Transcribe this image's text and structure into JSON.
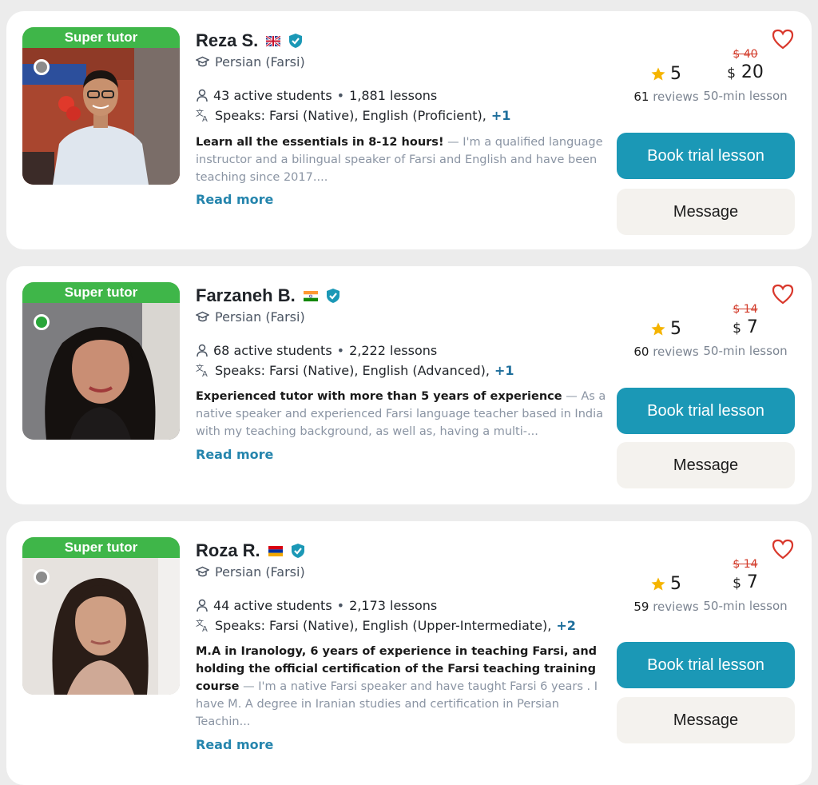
{
  "colors": {
    "super_badge": "#3fb649",
    "book_button": "#1b98b6",
    "message_button": "#f4f2ee",
    "old_price": "#d23b2a",
    "heart": "#d9372b",
    "star": "#f5b400",
    "verified": "#1b98b6",
    "link": "#2585ad"
  },
  "tutors": [
    {
      "badge": "Super tutor",
      "status": "offline",
      "name": "Reza S.",
      "flag": "uk-flag-icon",
      "subject": "Persian (Farsi)",
      "students": "43 active students",
      "lessons": "1,881 lessons",
      "speaks": "Speaks: Farsi (Native), English (Proficient),",
      "more_langs": "+1",
      "headline": "Learn all the essentials in 8-12 hours!",
      "description": " — I'm a qualified language instructor and a bilingual speaker of Farsi and English and have been teaching since 2017....",
      "read_more": "Read more",
      "rating": "5",
      "reviews_count": "61",
      "reviews_label": "reviews",
      "old_price": "$ 40",
      "currency": "$",
      "price": "20",
      "lesson_length": "50-min lesson",
      "book_label": "Book trial lesson",
      "message_label": "Message"
    },
    {
      "badge": "Super tutor",
      "status": "online",
      "name": "Farzaneh B.",
      "flag": "india-flag-icon",
      "subject": "Persian (Farsi)",
      "students": "68 active students",
      "lessons": "2,222 lessons",
      "speaks": "Speaks: Farsi (Native), English (Advanced),",
      "more_langs": "+1",
      "headline": "Experienced tutor with more than 5 years of experience",
      "description": " — As a native speaker and experienced Farsi language teacher based in India with my teaching background, as well as, having a multi-...",
      "read_more": "Read more",
      "rating": "5",
      "reviews_count": "60",
      "reviews_label": "reviews",
      "old_price": "$ 14",
      "currency": "$",
      "price": "7",
      "lesson_length": "50-min lesson",
      "book_label": "Book trial lesson",
      "message_label": "Message"
    },
    {
      "badge": "Super tutor",
      "status": "offline",
      "name": "Roza R.",
      "flag": "armenia-flag-icon",
      "subject": "Persian (Farsi)",
      "students": "44 active students",
      "lessons": "2,173 lessons",
      "speaks": "Speaks: Farsi (Native), English (Upper-Intermediate),",
      "more_langs": "+2",
      "headline": "M.A in Iranology, 6 years of experience in teaching Farsi, and holding the official certification of the Farsi teaching training course",
      "description": " — I'm a native Farsi speaker and have taught Farsi 6 years . I have M. A degree in Iranian studies and certification in Persian Teachin...",
      "read_more": "Read more",
      "rating": "5",
      "reviews_count": "59",
      "reviews_label": "reviews",
      "old_price": "$ 14",
      "currency": "$",
      "price": "7",
      "lesson_length": "50-min lesson",
      "book_label": "Book trial lesson",
      "message_label": "Message"
    }
  ]
}
